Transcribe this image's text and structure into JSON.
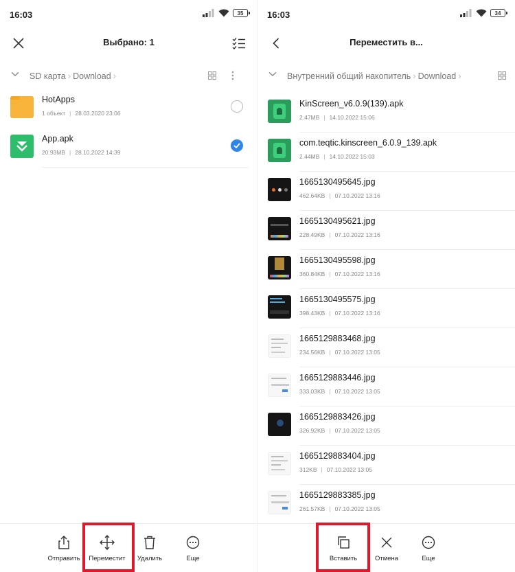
{
  "left": {
    "status": {
      "time": "16:03",
      "battery": "35"
    },
    "header": {
      "title": "Выбрано: 1",
      "close_icon": "close-icon",
      "select_all_icon": "checklist-icon"
    },
    "path": {
      "crumbs": [
        "SD карта",
        "Download"
      ]
    },
    "items": [
      {
        "name": "HotApps",
        "meta1": "1 объект",
        "meta2": "28.03.2020 23:06",
        "type": "folder",
        "selected": false
      },
      {
        "name": "App.apk",
        "meta1": "20.93MB",
        "meta2": "28.10.2022 14:39",
        "type": "apk",
        "selected": true
      }
    ],
    "toolbar": [
      {
        "label": "Отправить",
        "icon": "share-icon"
      },
      {
        "label": "Переместит",
        "icon": "move-icon"
      },
      {
        "label": "Удалить",
        "icon": "trash-icon"
      },
      {
        "label": "Еще",
        "icon": "more-icon"
      }
    ]
  },
  "right": {
    "status": {
      "time": "16:03",
      "battery": "34"
    },
    "header": {
      "title": "Переместить в...",
      "back_icon": "back-arrow-icon"
    },
    "path": {
      "crumbs": [
        "Внутренний общий накопитель",
        "Download"
      ]
    },
    "items": [
      {
        "name": "KinScreen_v6.0.9(139).apk",
        "size": "2.47MB",
        "date": "14.10.2022 15:06",
        "thumb": "apk"
      },
      {
        "name": "com.teqtic.kinscreen_6.0.9_139.apk",
        "size": "2.44MB",
        "date": "14.10.2022 15:03",
        "thumb": "apk"
      },
      {
        "name": "1665130495645.jpg",
        "size": "462.64KB",
        "date": "07.10.2022 13:16",
        "thumb": "dark-a"
      },
      {
        "name": "1665130495621.jpg",
        "size": "228.49KB",
        "date": "07.10.2022 13:16",
        "thumb": "dark-b"
      },
      {
        "name": "1665130495598.jpg",
        "size": "360.84KB",
        "date": "07.10.2022 13:16",
        "thumb": "dark-c"
      },
      {
        "name": "1665130495575.jpg",
        "size": "398.43KB",
        "date": "07.10.2022 13:16",
        "thumb": "dark-d"
      },
      {
        "name": "1665129883468.jpg",
        "size": "234.56KB",
        "date": "07.10.2022 13:05",
        "thumb": "light"
      },
      {
        "name": "1665129883446.jpg",
        "size": "333.03KB",
        "date": "07.10.2022 13:05",
        "thumb": "light-b"
      },
      {
        "name": "1665129883426.jpg",
        "size": "326.92KB",
        "date": "07.10.2022 13:05",
        "thumb": "dark-e"
      },
      {
        "name": "1665129883404.jpg",
        "size": "312KB",
        "date": "07.10.2022 13:05",
        "thumb": "light"
      },
      {
        "name": "1665129883385.jpg",
        "size": "261.57KB",
        "date": "07.10.2022 13:05",
        "thumb": "light-b"
      }
    ],
    "toolbar": [
      {
        "label": "Вставить",
        "icon": "paste-icon"
      },
      {
        "label": "Отмена",
        "icon": "cancel-icon"
      },
      {
        "label": "Еще",
        "icon": "more-icon"
      }
    ]
  },
  "colors": {
    "accent": "#2f86e8",
    "highlight": "#e0182b",
    "folder": "#f8b43a",
    "apk": "#2ebd6b"
  }
}
